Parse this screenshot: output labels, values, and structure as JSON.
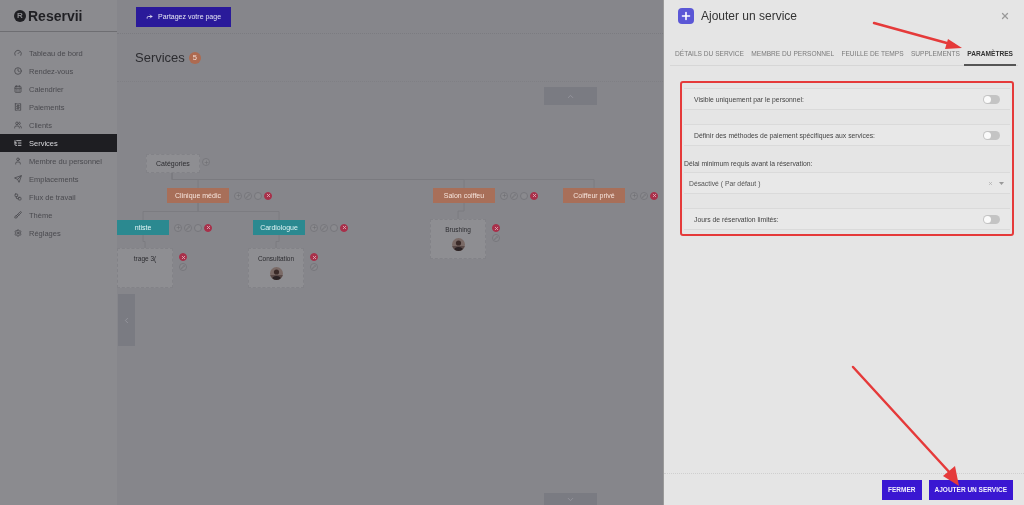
{
  "sidebar": {
    "logo_mark": "R",
    "logo": "Reservii",
    "items": [
      {
        "label": "Tableau de bord",
        "selected": false
      },
      {
        "label": "Rendez-vous",
        "selected": false
      },
      {
        "label": "Calendrier",
        "selected": false
      },
      {
        "label": "Paiements",
        "selected": false
      },
      {
        "label": "Clients",
        "selected": false
      },
      {
        "label": "Services",
        "selected": true
      },
      {
        "label": "Membre du personnel",
        "selected": false
      },
      {
        "label": "Emplacements",
        "selected": false
      },
      {
        "label": "Flux de travail",
        "selected": false
      },
      {
        "label": "Thème",
        "selected": false
      },
      {
        "label": "Réglages",
        "selected": false
      }
    ]
  },
  "share_button": "Partagez votre page",
  "page": {
    "title": "Services",
    "count": "5"
  },
  "tree": {
    "root": "Catégories",
    "children": [
      {
        "kind": "category",
        "label": "Clinique médic",
        "children": [
          {
            "kind": "subcategory",
            "label": "ntiste",
            "children": [
              {
                "kind": "service",
                "label": "trage 3("
              }
            ]
          },
          {
            "kind": "subcategory",
            "label": "Cardiologue",
            "children": [
              {
                "kind": "service",
                "label": "Consultation"
              }
            ]
          }
        ]
      },
      {
        "kind": "category",
        "label": "Salon coiffeu",
        "children": [
          {
            "kind": "service",
            "label": "Brushing"
          }
        ]
      },
      {
        "kind": "category",
        "label": "Coiffeur privé"
      }
    ]
  },
  "drawer": {
    "title": "Ajouter un service",
    "tabs": [
      {
        "label": "DÉTAILS DU SERVICE",
        "selected": false
      },
      {
        "label": "MEMBRE DU PERSONNEL",
        "selected": false
      },
      {
        "label": "FEUILLE DE TEMPS",
        "selected": false
      },
      {
        "label": "SUPPLEMENTS",
        "selected": false
      },
      {
        "label": "PARAMÈTRES",
        "selected": true
      }
    ],
    "settings": [
      {
        "kind": "toggle",
        "label": "Visible uniquement par le personnel:",
        "on": false
      },
      {
        "kind": "toggle",
        "label": "Définir des méthodes de paiement spécifiques aux services:",
        "on": false
      },
      {
        "kind": "select",
        "label": "Délai minimum requis avant la réservation:",
        "value": "Désactivé ( Par défaut )"
      },
      {
        "kind": "toggle",
        "label": "Jours de réservation limités:",
        "on": false
      }
    ],
    "buttons": [
      "FERMER",
      "AJOUTER UN SERVICE"
    ]
  }
}
